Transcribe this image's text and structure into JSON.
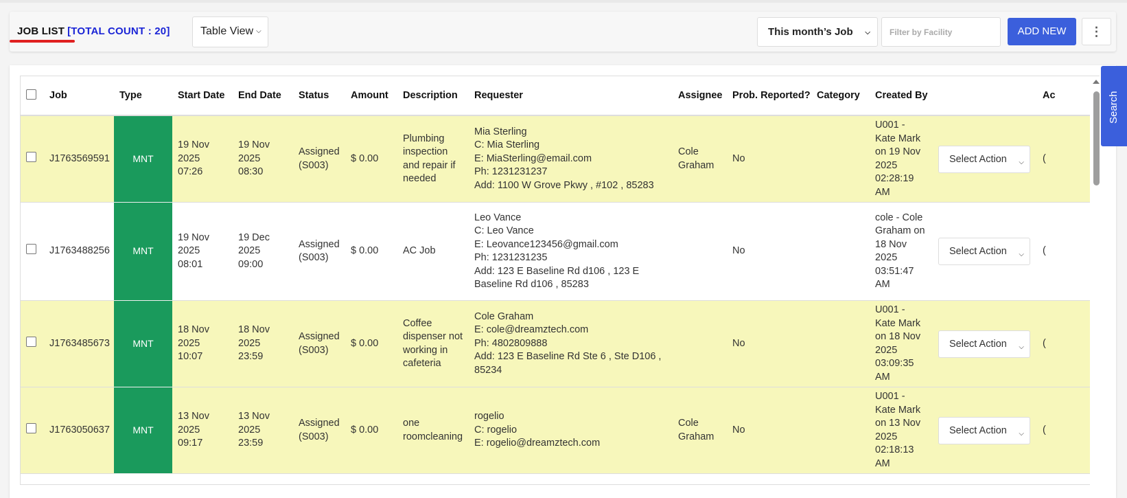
{
  "header": {
    "title": "JOB LIST",
    "total_count": "[TOTAL COUNT : 20]",
    "view_select": "Table View",
    "period_select": "This month’s Job",
    "facility_placeholder": "Filter by Facility",
    "add_new": "ADD NEW",
    "more_icon": "⋮"
  },
  "search_tab": "Search",
  "table": {
    "columns": [
      "Job",
      "Type",
      "Start Date",
      "End Date",
      "Status",
      "Amount",
      "Description",
      "Requester",
      "Assignee",
      "Prob. Reported?",
      "Category",
      "Created By",
      "",
      "Ac"
    ],
    "rows": [
      {
        "job": "J1763569591",
        "type": "MNT",
        "start": "19 Nov 2025 07:26",
        "end": "19 Nov 2025 08:30",
        "status": "Assigned (S003)",
        "amount": "$ 0.00",
        "description": "Plumbing inspection and repair if needed",
        "requester": [
          "Mia Sterling",
          "C: Mia Sterling",
          "E: MiaSterling@email.com",
          "Ph: 1231231237",
          "Add: 1100 W Grove Pkwy , #102 , 85283"
        ],
        "assignee": "Cole Graham",
        "prob": "No",
        "category": "",
        "created_by": "U001 - Kate Mark on 19 Nov 2025 02:28:19 AM",
        "action": "Select Action",
        "extra": "("
      },
      {
        "job": "J1763488256",
        "type": "MNT",
        "start": "19 Nov 2025 08:01",
        "end": "19 Dec 2025 09:00",
        "status": "Assigned (S003)",
        "amount": "$ 0.00",
        "description": "AC Job",
        "requester": [
          "Leo Vance",
          "C: Leo Vance",
          "E: Leovance123456@gmail.com",
          "Ph: 1231231235",
          "Add: 123 E Baseline Rd d106 , 123 E Baseline Rd d106 , 85283"
        ],
        "assignee": "",
        "prob": "No",
        "category": "",
        "created_by": "cole - Cole Graham on 18 Nov 2025 03:51:47 AM",
        "action": "Select Action",
        "extra": "("
      },
      {
        "job": "J1763485673",
        "type": "MNT",
        "start": "18 Nov 2025 10:07",
        "end": "18 Nov 2025 23:59",
        "status": "Assigned (S003)",
        "amount": "$ 0.00",
        "description": "Coffee dispenser not working in cafeteria",
        "requester": [
          "Cole Graham",
          "E: cole@dreamztech.com",
          "Ph: 4802809888",
          "Add: 123 E Baseline Rd Ste 6 , Ste D106 , 85234"
        ],
        "assignee": "",
        "prob": "No",
        "category": "",
        "created_by": "U001 - Kate Mark on 18 Nov 2025 03:09:35 AM",
        "action": "Select Action",
        "extra": "("
      },
      {
        "job": "J1763050637",
        "type": "MNT",
        "start": "13 Nov 2025 09:17",
        "end": "13 Nov 2025 23:59",
        "status": "Assigned (S003)",
        "amount": "$ 0.00",
        "description": "one roomcleaning",
        "requester": [
          "rogelio",
          "C: rogelio",
          "E: rogelio@dreamztech.com"
        ],
        "assignee": "Cole Graham",
        "prob": "No",
        "category": "",
        "created_by": "U001 - Kate Mark on 13 Nov 2025 02:18:13 AM",
        "action": "Select Action",
        "extra": "("
      }
    ]
  }
}
